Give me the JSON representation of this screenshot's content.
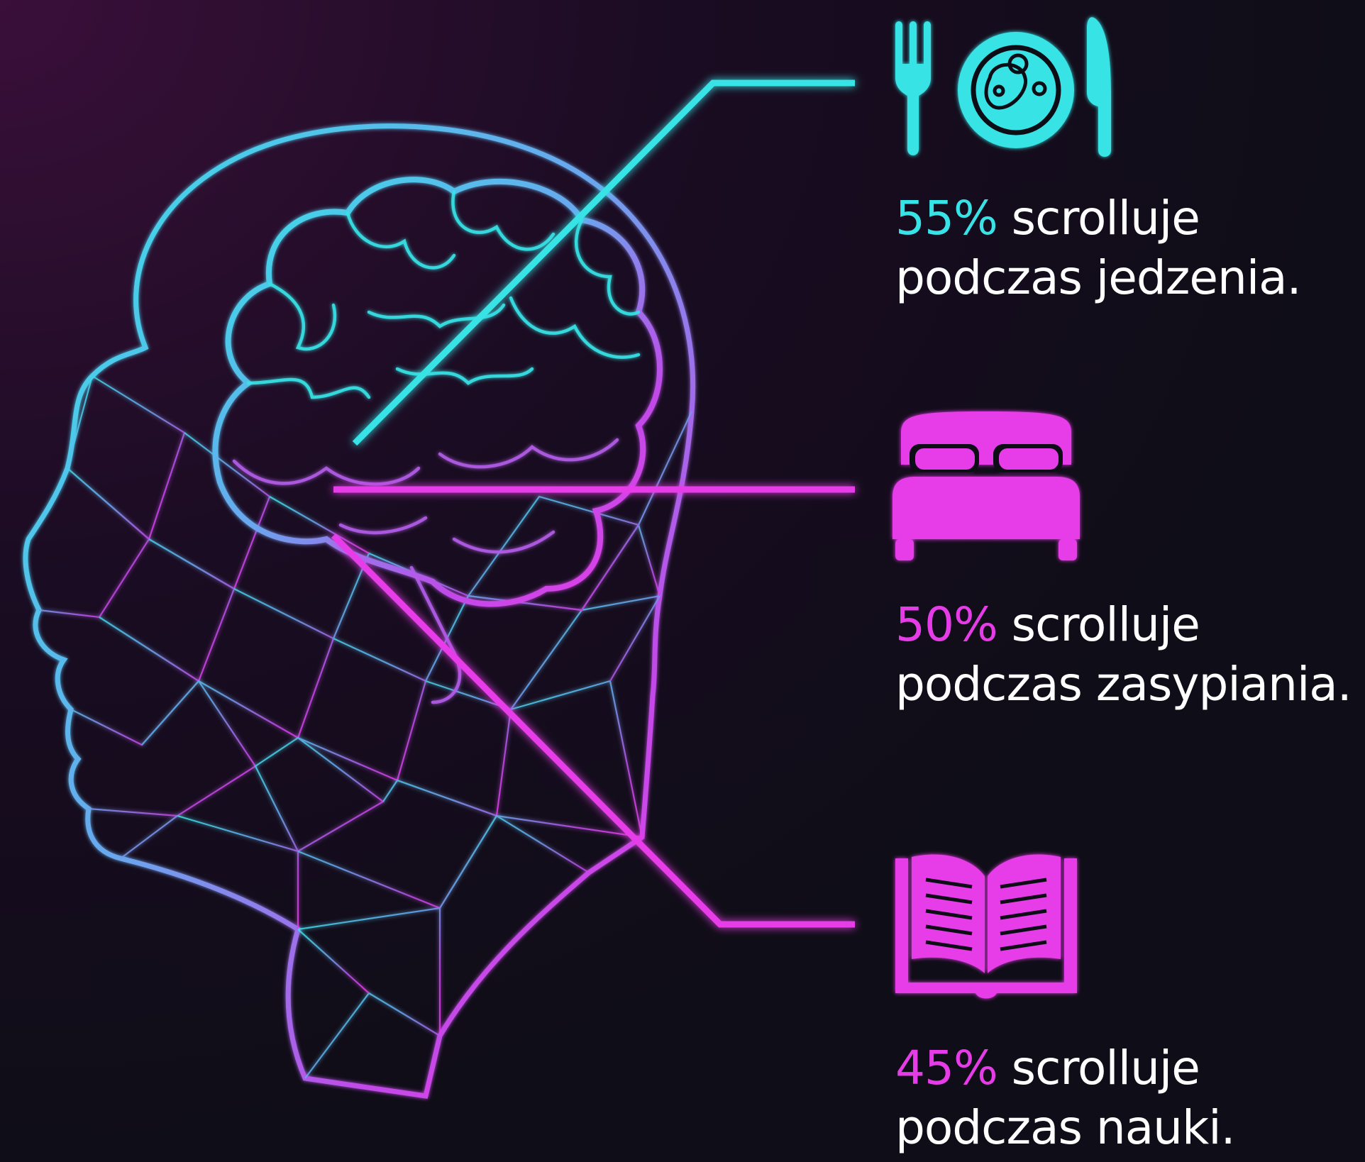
{
  "colors": {
    "cyan": "#37e3e6",
    "magenta": "#e63ce8",
    "text": "#ffffff",
    "background": "#0f0d17"
  },
  "items": [
    {
      "icon": "plate-with-fork-and-knife-icon",
      "percent": "55%",
      "line1_rest": " scrolluje",
      "line2": "podczas jedzenia."
    },
    {
      "icon": "bed-icon",
      "percent": "50%",
      "line1_rest": " scrolluje",
      "line2": "podczas zasypiania."
    },
    {
      "icon": "open-book-icon",
      "percent": "45%",
      "line1_rest": " scrolluje",
      "line2": "podczas nauki."
    }
  ]
}
